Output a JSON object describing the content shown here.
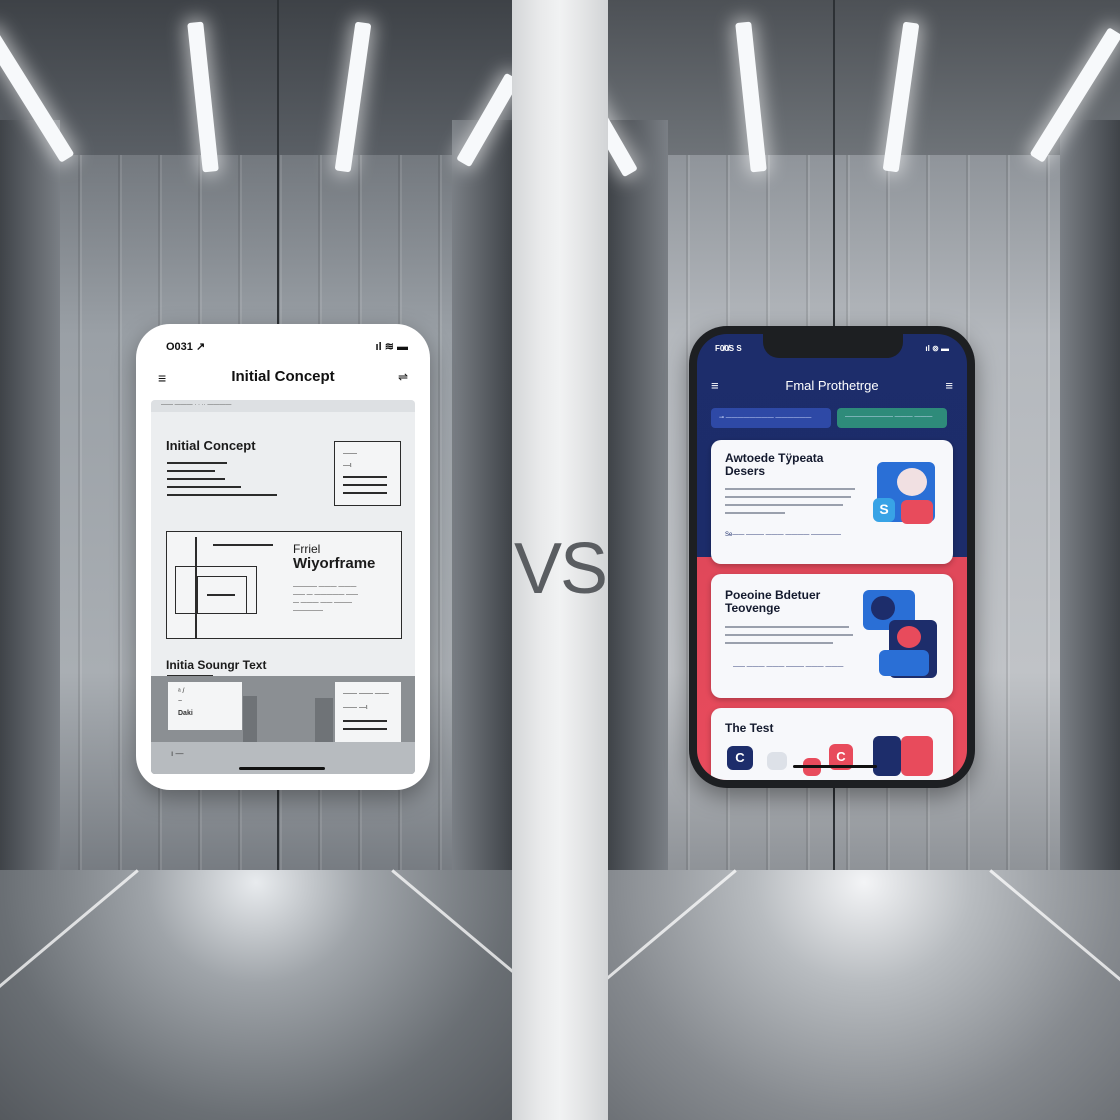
{
  "divider": {
    "label": "VS"
  },
  "left_phone": {
    "status_time": "O031 ↗",
    "status_icons": "ıl ≋ ▬",
    "header": {
      "title": "Initial Concept",
      "menu_icon": "hamburger-icon",
      "options_icon": "sliders-icon"
    },
    "search_strip": "—— ——— ·  ·  ·· ————",
    "section_1": {
      "heading": "Initial Concept",
      "box_lines": [
        "——",
        "—ι"
      ]
    },
    "section_2": {
      "heading_line1": "Frriel",
      "heading_line2": "Wiyorframe",
      "caption_lines": [
        "———— ——— ———",
        "—— — ————— ——",
        "— ——— —— ———",
        "—————"
      ]
    },
    "section_3": {
      "heading": "Initia Soungr Text",
      "left_box_lines": [
        "ᵃ /",
        "~",
        "Daki"
      ],
      "right_box_lines": [
        "—— —— ——",
        "—— —ι"
      ]
    },
    "footer_text": "ı —"
  },
  "right_phone": {
    "status_time": "F0̸0̸S S",
    "status_icons": "ıl ⊚ ▬",
    "header": {
      "title": "Fmal Prothetrge",
      "menu_icon": "hamburger-icon",
      "options_icon": "hamburger-icon"
    },
    "pills": [
      "⊸ ———————— ——————",
      "———————— ——— ———"
    ],
    "card_1": {
      "title_line1": "Awtoede Tÿpeata",
      "title_line2": "Desers",
      "foot": "Se—— ——— ——— ———— —————"
    },
    "card_2": {
      "title_line1": "Poeoine Bdetuer",
      "title_line2": "Teovenge",
      "foot": "—— ——— ——— ——— ——— ———"
    },
    "card_3": {
      "title": "The Test"
    },
    "colors": {
      "navy": "#1d2d6b",
      "coral": "#e84b5c",
      "teal": "#2e8b7a",
      "blue": "#2a6fd6"
    }
  }
}
